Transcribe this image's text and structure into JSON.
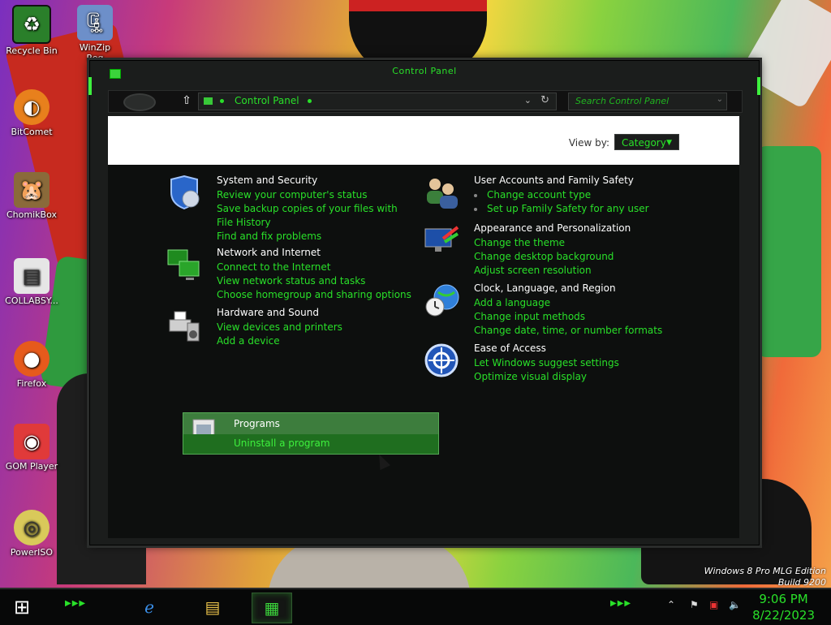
{
  "desktop": {
    "icons": [
      {
        "label": "Recycle Bin",
        "icon": "recycle-bin-icon"
      },
      {
        "label": "WinZip",
        "sub": "Reg",
        "icon": "winzip-icon"
      },
      {
        "label": "BitComet",
        "icon": "bitcomet-icon"
      },
      {
        "label": "ChomikBox",
        "icon": "chomikbox-icon"
      },
      {
        "label": "COLLABSY...",
        "icon": "file-icon"
      },
      {
        "label": "Firefox",
        "icon": "firefox-icon"
      },
      {
        "label": "GOM Player",
        "icon": "gom-player-icon"
      },
      {
        "label": "PowerISO",
        "icon": "poweriso-icon"
      }
    ],
    "watermark": [
      "Windows 8 Pro MLG Edition",
      "Build 9200"
    ]
  },
  "window": {
    "title": "Control Panel",
    "address": {
      "crumb": "Control Panel"
    },
    "search": {
      "placeholder": "Search Control Panel"
    },
    "view_by_label": "View by:",
    "view_by_value": "Category"
  },
  "categories": {
    "system": {
      "title": "System and Security",
      "links": [
        "Review your computer's status",
        "Save backup copies of your files with File History",
        "Find and fix problems"
      ]
    },
    "network": {
      "title": "Network and Internet",
      "links": [
        "Connect to the Internet",
        "View network status and tasks",
        "Choose homegroup and sharing options"
      ]
    },
    "hardware": {
      "title": "Hardware and Sound",
      "links": [
        "View devices and printers",
        "Add a device"
      ]
    },
    "programs": {
      "title": "Programs",
      "links": [
        "Uninstall a program"
      ]
    },
    "users": {
      "title": "User Accounts and Family Safety",
      "links": [
        "Change account type",
        "Set up Family Safety for any user"
      ]
    },
    "appearance": {
      "title": "Appearance and Personalization",
      "links": [
        "Change the theme",
        "Change desktop background",
        "Adjust screen resolution"
      ]
    },
    "clock": {
      "title": "Clock, Language, and Region",
      "links": [
        "Add a language",
        "Change input methods",
        "Change date, time, or number formats"
      ]
    },
    "ease": {
      "title": "Ease of Access",
      "links": [
        "Let Windows suggest settings",
        "Optimize visual display"
      ]
    }
  },
  "taskbar": {
    "clock_time": "9:06 PM",
    "clock_date": "8/22/2023"
  }
}
